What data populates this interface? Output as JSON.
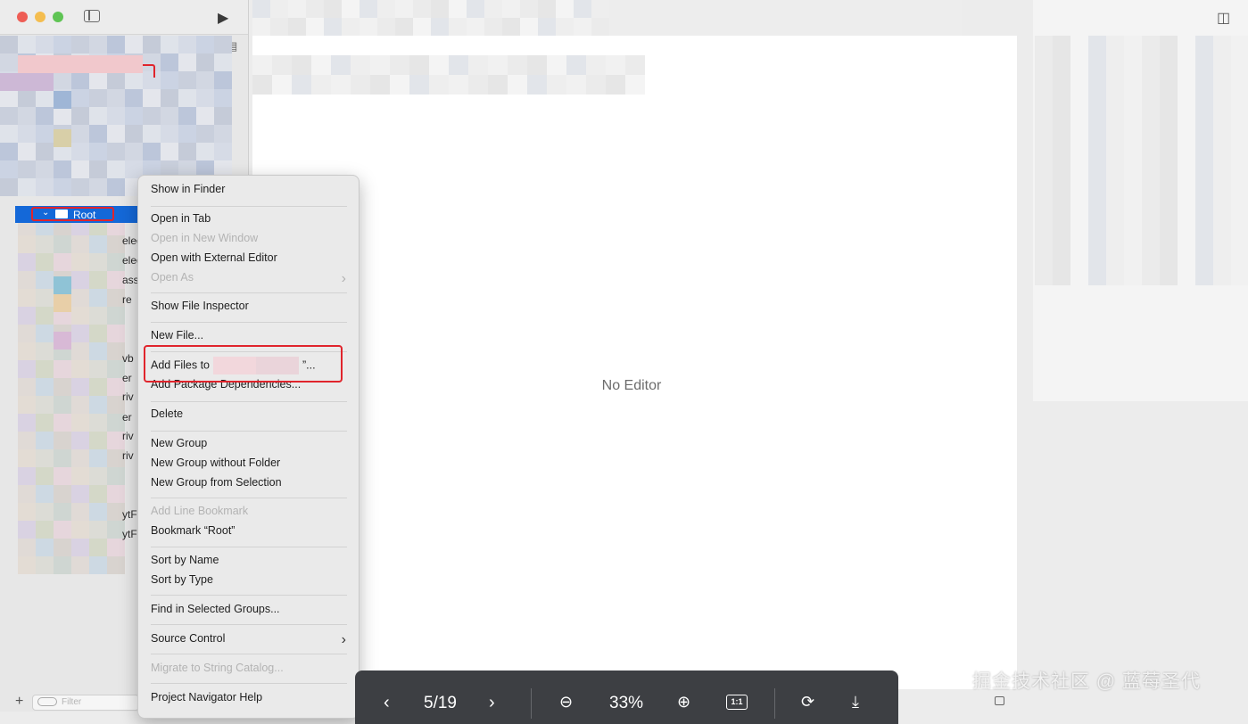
{
  "navigator": {
    "root_label": "Root",
    "filter_placeholder": "Filter",
    "add_symbol": "+",
    "peek_text": [
      "eleg",
      "eleg",
      "ass",
      "re",
      "vb",
      "er",
      "riv",
      "er",
      "riv",
      "riv",
      "ytF",
      "ytF"
    ]
  },
  "editor": {
    "empty_label": "No Editor"
  },
  "context_menu": {
    "items": [
      {
        "label": "Show in Finder",
        "enabled": true
      },
      {
        "label": "Open in Tab",
        "enabled": true
      },
      {
        "label": "Open in New Window",
        "enabled": false
      },
      {
        "label": "Open with External Editor",
        "enabled": true
      },
      {
        "label": "Open As",
        "enabled": false,
        "submenu": true
      },
      {
        "label": "Show File Inspector",
        "enabled": true
      },
      {
        "label": "New File...",
        "enabled": true
      },
      {
        "label": "Add Files to",
        "suffix": "”...",
        "enabled": true
      },
      {
        "label": "Add Package Dependencies...",
        "enabled": true
      },
      {
        "label": "Delete",
        "enabled": true
      },
      {
        "label": "New Group",
        "enabled": true
      },
      {
        "label": "New Group without Folder",
        "enabled": true
      },
      {
        "label": "New Group from Selection",
        "enabled": true
      },
      {
        "label": "Add Line Bookmark",
        "enabled": false
      },
      {
        "label": "Bookmark “Root”",
        "enabled": true
      },
      {
        "label": "Sort by Name",
        "enabled": true
      },
      {
        "label": "Sort by Type",
        "enabled": true
      },
      {
        "label": "Find in Selected Groups...",
        "enabled": true
      },
      {
        "label": "Source Control",
        "enabled": true,
        "submenu": true
      },
      {
        "label": "Migrate to String Catalog...",
        "enabled": false
      },
      {
        "label": "Project Navigator Help",
        "enabled": true
      }
    ]
  },
  "viewer": {
    "page": "5/19",
    "zoom": "33%",
    "actual_size": "1:1"
  },
  "watermark": "掘金技术社区 @ 蓝莓圣代",
  "colors": {
    "selection": "#1468d8",
    "highlight": "#e0242c",
    "viewer_bar": "#3d3f43"
  }
}
